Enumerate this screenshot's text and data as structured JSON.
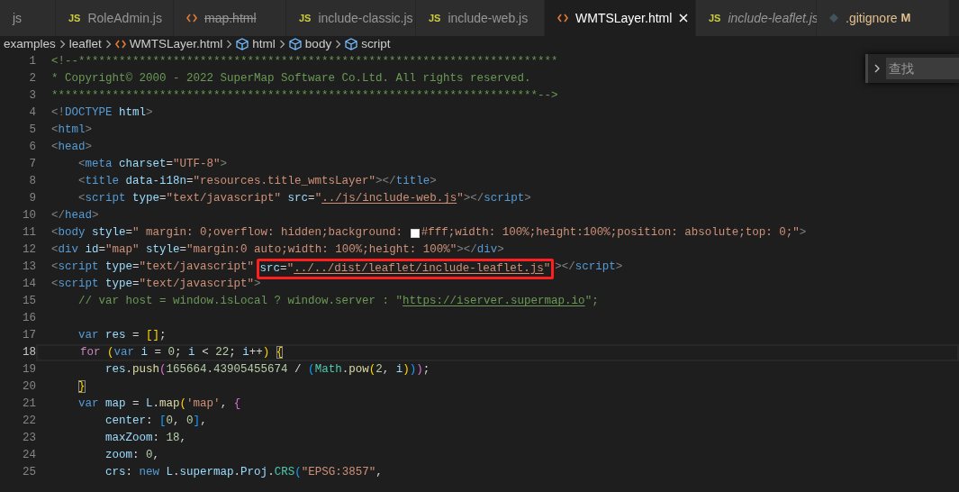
{
  "tabs": [
    {
      "label": "js",
      "kind": "none",
      "selected": false,
      "deleted": false,
      "preview": false
    },
    {
      "label": "RoleAdmin.js",
      "kind": "js",
      "icon_text": "JS",
      "selected": false,
      "deleted": false,
      "preview": false
    },
    {
      "label": "map.html",
      "kind": "html",
      "selected": false,
      "deleted": true,
      "preview": false
    },
    {
      "label": "include-classic.js",
      "kind": "js",
      "icon_text": "JS",
      "selected": false,
      "deleted": false,
      "preview": false
    },
    {
      "label": "include-web.js",
      "kind": "js",
      "icon_text": "JS",
      "selected": false,
      "deleted": false,
      "preview": false
    },
    {
      "label": "WMTSLayer.html",
      "kind": "html",
      "selected": true,
      "deleted": false,
      "preview": false
    },
    {
      "label": "include-leaflet.js",
      "kind": "js",
      "icon_text": "JS",
      "selected": false,
      "deleted": false,
      "preview": true
    },
    {
      "label": ".gitignore",
      "kind": "git",
      "git_status": "M",
      "selected": false,
      "deleted": false,
      "preview": false
    }
  ],
  "breadcrumb": [
    {
      "label": "examples",
      "kind": "folder"
    },
    {
      "label": "leaflet",
      "kind": "folder"
    },
    {
      "label": "WMTSLayer.html",
      "kind": "html"
    },
    {
      "label": "html",
      "kind": "element"
    },
    {
      "label": "body",
      "kind": "element"
    },
    {
      "label": "script",
      "kind": "element"
    }
  ],
  "find_widget": {
    "placeholder": "查找"
  },
  "lines": [
    {
      "number": "1",
      "current": false,
      "tokens": [
        {
          "kind": "comment",
          "text": "<!--***********************************************************************"
        }
      ]
    },
    {
      "number": "2",
      "current": false,
      "tokens": [
        {
          "kind": "comment",
          "text": "* Copyright© 2000 - 2022 SuperMap Software Co.Ltd. All rights reserved."
        }
      ]
    },
    {
      "number": "3",
      "current": false,
      "tokens": [
        {
          "kind": "comment",
          "text": "************************************************************************-->"
        }
      ]
    },
    {
      "number": "4",
      "current": false,
      "tokens": [
        {
          "kind": "punct",
          "text": "<!"
        },
        {
          "kind": "tag",
          "text": "DOCTYPE "
        },
        {
          "kind": "attr",
          "text": "html"
        },
        {
          "kind": "punct",
          "text": ">"
        }
      ]
    },
    {
      "number": "5",
      "current": false,
      "tokens": [
        {
          "kind": "punct",
          "text": "<"
        },
        {
          "kind": "tag",
          "text": "html"
        },
        {
          "kind": "punct",
          "text": ">"
        }
      ]
    },
    {
      "number": "6",
      "current": false,
      "tokens": [
        {
          "kind": "punct",
          "text": "<"
        },
        {
          "kind": "tag",
          "text": "head"
        },
        {
          "kind": "punct",
          "text": ">"
        }
      ]
    },
    {
      "number": "7",
      "current": false,
      "tokens": [
        {
          "kind": "punct",
          "text": "    <"
        },
        {
          "kind": "tag",
          "text": "meta "
        },
        {
          "kind": "attr",
          "text": "charset"
        },
        {
          "kind": "text",
          "text": "="
        },
        {
          "kind": "string",
          "text": "\"UTF-8\""
        },
        {
          "kind": "punct",
          "text": ">"
        }
      ]
    },
    {
      "number": "8",
      "current": false,
      "tokens": [
        {
          "kind": "punct",
          "text": "    <"
        },
        {
          "kind": "tag",
          "text": "title "
        },
        {
          "kind": "attr",
          "text": "data-i18n"
        },
        {
          "kind": "text",
          "text": "="
        },
        {
          "kind": "string",
          "text": "\"resources.title_wmtsLayer\""
        },
        {
          "kind": "punct",
          "text": "></"
        },
        {
          "kind": "tag",
          "text": "title"
        },
        {
          "kind": "punct",
          "text": ">"
        }
      ]
    },
    {
      "number": "9",
      "current": false,
      "tokens": [
        {
          "kind": "punct",
          "text": "    <"
        },
        {
          "kind": "tag",
          "text": "script "
        },
        {
          "kind": "attr",
          "text": "type"
        },
        {
          "kind": "text",
          "text": "="
        },
        {
          "kind": "string",
          "text": "\"text/javascript\" "
        },
        {
          "kind": "attr",
          "text": "src"
        },
        {
          "kind": "text",
          "text": "="
        },
        {
          "kind": "string",
          "text": "\""
        },
        {
          "kind": "link",
          "text": "../js/include-web.js"
        },
        {
          "kind": "string",
          "text": "\""
        },
        {
          "kind": "punct",
          "text": "></"
        },
        {
          "kind": "tag",
          "text": "script"
        },
        {
          "kind": "punct",
          "text": ">"
        }
      ]
    },
    {
      "number": "10",
      "current": false,
      "tokens": [
        {
          "kind": "punct",
          "text": "</"
        },
        {
          "kind": "tag",
          "text": "head"
        },
        {
          "kind": "punct",
          "text": ">"
        }
      ]
    },
    {
      "number": "11",
      "current": false,
      "tokens": [
        {
          "kind": "punct",
          "text": "<"
        },
        {
          "kind": "tag",
          "text": "body "
        },
        {
          "kind": "attr",
          "text": "style"
        },
        {
          "kind": "text",
          "text": "="
        },
        {
          "kind": "string",
          "text": "\" margin: 0;overflow: hidden;background: "
        },
        {
          "kind": "swatch",
          "color": "#ffffff"
        },
        {
          "kind": "string",
          "text": "#fff;width: 100%;height:100%;position: absolute;top: 0;\""
        },
        {
          "kind": "punct",
          "text": ">"
        }
      ]
    },
    {
      "number": "12",
      "current": false,
      "tokens": [
        {
          "kind": "punct",
          "text": "<"
        },
        {
          "kind": "tag",
          "text": "div "
        },
        {
          "kind": "attr",
          "text": "id"
        },
        {
          "kind": "text",
          "text": "="
        },
        {
          "kind": "string",
          "text": "\"map\" "
        },
        {
          "kind": "attr",
          "text": "style"
        },
        {
          "kind": "text",
          "text": "="
        },
        {
          "kind": "string",
          "text": "\"margin:0 auto;width: 100%;height: 100%\""
        },
        {
          "kind": "punct",
          "text": "></"
        },
        {
          "kind": "tag",
          "text": "div"
        },
        {
          "kind": "punct",
          "text": ">"
        }
      ]
    },
    {
      "number": "13",
      "current": false,
      "tokens": [
        {
          "kind": "punct",
          "text": "<"
        },
        {
          "kind": "tag",
          "text": "script "
        },
        {
          "kind": "attr",
          "text": "type"
        },
        {
          "kind": "text",
          "text": "="
        },
        {
          "kind": "string",
          "text": "\"text/javascript\" "
        },
        {
          "kind": "attr",
          "text": "src",
          "annotated": true
        },
        {
          "kind": "text",
          "text": "=",
          "annotated": true
        },
        {
          "kind": "string",
          "text": "\"",
          "annotated": true
        },
        {
          "kind": "link",
          "text": "../../dist/leaflet/include-leaflet.js",
          "annotated": true
        },
        {
          "kind": "string",
          "text": "\"",
          "annotated": true
        },
        {
          "kind": "punct",
          "text": "></"
        },
        {
          "kind": "tag",
          "text": "script"
        },
        {
          "kind": "punct",
          "text": ">"
        }
      ]
    },
    {
      "number": "14",
      "current": false,
      "tokens": [
        {
          "kind": "punct",
          "text": "<"
        },
        {
          "kind": "tag",
          "text": "script "
        },
        {
          "kind": "attr",
          "text": "type"
        },
        {
          "kind": "text",
          "text": "="
        },
        {
          "kind": "string",
          "text": "\"text/javascript\""
        },
        {
          "kind": "punct",
          "text": ">"
        }
      ]
    },
    {
      "number": "15",
      "current": false,
      "tokens": [
        {
          "kind": "comment",
          "text": "    // var host = window.isLocal ? window.server : \""
        },
        {
          "kind": "comment_link",
          "text": "https://iserver.supermap.io"
        },
        {
          "kind": "comment",
          "text": "\";"
        }
      ]
    },
    {
      "number": "16",
      "current": false
    },
    {
      "number": "17",
      "current": false,
      "tokens": [
        {
          "kind": "keyword",
          "text": "    var "
        },
        {
          "kind": "var",
          "text": "res"
        },
        {
          "kind": "text",
          "text": " = "
        },
        {
          "kind": "b1",
          "text": "[]"
        },
        {
          "kind": "text",
          "text": ";"
        }
      ]
    },
    {
      "number": "18",
      "current": true,
      "tokens": [
        {
          "kind": "control",
          "text": "    for "
        },
        {
          "kind": "b1",
          "text": "("
        },
        {
          "kind": "keyword",
          "text": "var "
        },
        {
          "kind": "var",
          "text": "i"
        },
        {
          "kind": "text",
          "text": " = "
        },
        {
          "kind": "num",
          "text": "0"
        },
        {
          "kind": "text",
          "text": "; "
        },
        {
          "kind": "var",
          "text": "i"
        },
        {
          "kind": "text",
          "text": " < "
        },
        {
          "kind": "num",
          "text": "22"
        },
        {
          "kind": "text",
          "text": "; "
        },
        {
          "kind": "var",
          "text": "i"
        },
        {
          "kind": "text",
          "text": "++"
        },
        {
          "kind": "b1",
          "text": ") "
        },
        {
          "kind": "b1",
          "text": "{",
          "matched": true
        }
      ]
    },
    {
      "number": "19",
      "current": false,
      "tokens": [
        {
          "kind": "var",
          "text": "        res"
        },
        {
          "kind": "text",
          "text": "."
        },
        {
          "kind": "func",
          "text": "push"
        },
        {
          "kind": "b2",
          "text": "("
        },
        {
          "kind": "num",
          "text": "165664.43905455674"
        },
        {
          "kind": "text",
          "text": " / "
        },
        {
          "kind": "b3",
          "text": "("
        },
        {
          "kind": "class",
          "text": "Math"
        },
        {
          "kind": "text",
          "text": "."
        },
        {
          "kind": "func",
          "text": "pow"
        },
        {
          "kind": "b1",
          "text": "("
        },
        {
          "kind": "num",
          "text": "2"
        },
        {
          "kind": "text",
          "text": ", "
        },
        {
          "kind": "var",
          "text": "i"
        },
        {
          "kind": "b1",
          "text": ")"
        },
        {
          "kind": "b3",
          "text": ")"
        },
        {
          "kind": "b2",
          "text": ")"
        },
        {
          "kind": "text",
          "text": ";"
        }
      ]
    },
    {
      "number": "20",
      "current": false,
      "tokens": [
        {
          "kind": "b1",
          "text": "    }",
          "matched": true
        }
      ]
    },
    {
      "number": "21",
      "current": false,
      "tokens": [
        {
          "kind": "keyword",
          "text": "    var "
        },
        {
          "kind": "var",
          "text": "map"
        },
        {
          "kind": "text",
          "text": " = "
        },
        {
          "kind": "var",
          "text": "L"
        },
        {
          "kind": "text",
          "text": "."
        },
        {
          "kind": "func",
          "text": "map"
        },
        {
          "kind": "b1",
          "text": "("
        },
        {
          "kind": "string",
          "text": "'map'"
        },
        {
          "kind": "text",
          "text": ", "
        },
        {
          "kind": "b2",
          "text": "{"
        }
      ]
    },
    {
      "number": "22",
      "current": false,
      "tokens": [
        {
          "kind": "var",
          "text": "        center"
        },
        {
          "kind": "text",
          "text": ": "
        },
        {
          "kind": "b3",
          "text": "["
        },
        {
          "kind": "num",
          "text": "0"
        },
        {
          "kind": "text",
          "text": ", "
        },
        {
          "kind": "num",
          "text": "0"
        },
        {
          "kind": "b3",
          "text": "]"
        },
        {
          "kind": "text",
          "text": ","
        }
      ]
    },
    {
      "number": "23",
      "current": false,
      "tokens": [
        {
          "kind": "var",
          "text": "        maxZoom"
        },
        {
          "kind": "text",
          "text": ": "
        },
        {
          "kind": "num",
          "text": "18"
        },
        {
          "kind": "text",
          "text": ","
        }
      ]
    },
    {
      "number": "24",
      "current": false,
      "tokens": [
        {
          "kind": "var",
          "text": "        zoom"
        },
        {
          "kind": "text",
          "text": ": "
        },
        {
          "kind": "num",
          "text": "0"
        },
        {
          "kind": "text",
          "text": ","
        }
      ]
    },
    {
      "number": "25",
      "current": false,
      "tokens": [
        {
          "kind": "var",
          "text": "        crs"
        },
        {
          "kind": "text",
          "text": ": "
        },
        {
          "kind": "keyword",
          "text": "new "
        },
        {
          "kind": "var",
          "text": "L"
        },
        {
          "kind": "text",
          "text": "."
        },
        {
          "kind": "var",
          "text": "supermap"
        },
        {
          "kind": "text",
          "text": "."
        },
        {
          "kind": "var",
          "text": "Proj"
        },
        {
          "kind": "text",
          "text": "."
        },
        {
          "kind": "class",
          "text": "CRS"
        },
        {
          "kind": "b3",
          "text": "("
        },
        {
          "kind": "string",
          "text": "\"EPSG:3857\""
        },
        {
          "kind": "text",
          "text": ","
        }
      ]
    }
  ]
}
